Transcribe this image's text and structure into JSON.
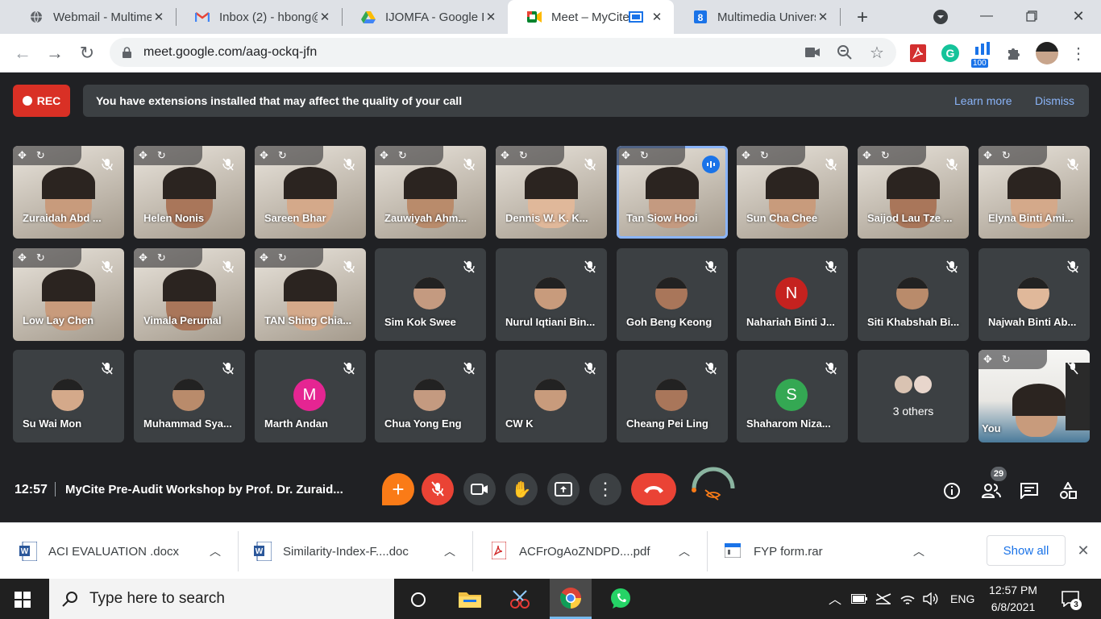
{
  "browser": {
    "tabs": [
      {
        "title": "Webmail - Multimedia",
        "icon": "globe-icon"
      },
      {
        "title": "Inbox (2) - hbong@",
        "icon": "gmail-icon"
      },
      {
        "title": "IJOMFA - Google Drive",
        "icon": "drive-icon"
      },
      {
        "title": "Meet – MyCite",
        "icon": "meet-icon"
      },
      {
        "title": "Multimedia University",
        "icon": "mmu-icon"
      }
    ],
    "url": "meet.google.com/aag-ockq-jfn",
    "badge_count": "100"
  },
  "meet": {
    "rec_label": "REC",
    "banner_text": "You have extensions installed that may affect the quality of your call",
    "learn_more": "Learn more",
    "dismiss": "Dismiss",
    "participants_row1": [
      {
        "name": "Zuraidah Abd ...",
        "video": true
      },
      {
        "name": "Helen Nonis",
        "video": true
      },
      {
        "name": "Sareen Bhar",
        "video": true
      },
      {
        "name": "Zauwiyah Ahm...",
        "video": true
      },
      {
        "name": "Dennis W. K. K...",
        "video": true
      },
      {
        "name": "Tan Siow Hooi",
        "video": true,
        "speaking": true
      },
      {
        "name": "Sun Cha Chee",
        "video": true
      },
      {
        "name": "Saijod Lau Tze ...",
        "video": true
      },
      {
        "name": "Elyna Binti Ami...",
        "video": true
      }
    ],
    "participants_row2": [
      {
        "name": "Low Lay Chen",
        "video": true
      },
      {
        "name": "Vimala Perumal",
        "video": true
      },
      {
        "name": "TAN Shing Chia...",
        "video": true
      },
      {
        "name": "Sim Kok Swee",
        "video": false
      },
      {
        "name": "Nurul Iqtiani Bin...",
        "video": false
      },
      {
        "name": "Goh Beng Keong",
        "video": false
      },
      {
        "name": "Nahariah Binti J...",
        "video": false,
        "initial": "N",
        "color": "#c5221f"
      },
      {
        "name": "Siti Khabshah Bi...",
        "video": false
      },
      {
        "name": "Najwah Binti Ab...",
        "video": false
      }
    ],
    "participants_row3": [
      {
        "name": "Su Wai Mon",
        "video": false
      },
      {
        "name": "Muhammad Sya...",
        "video": false
      },
      {
        "name": "Marth Andan",
        "video": false,
        "initial": "M",
        "color": "#e52592"
      },
      {
        "name": "Chua Yong Eng",
        "video": false
      },
      {
        "name": "CW K",
        "video": false
      },
      {
        "name": "Cheang Pei Ling",
        "video": false
      },
      {
        "name": "Shaharom Niza...",
        "video": false,
        "initial": "S",
        "color": "#34a853"
      }
    ],
    "others_label": "3 others",
    "self_label": "You",
    "time": "12:57",
    "meeting_title": "MyCite Pre-Audit Workshop by Prof. Dr. Zuraid...",
    "people_count": "29"
  },
  "downloads": {
    "items": [
      {
        "name": "ACI EVALUATION .docx",
        "icon": "word-icon"
      },
      {
        "name": "Similarity-Index-F....doc",
        "icon": "word-icon"
      },
      {
        "name": "ACFrOgAoZNDPD....pdf",
        "icon": "pdf-icon"
      },
      {
        "name": "FYP form.rar",
        "icon": "rar-icon"
      }
    ],
    "show_all": "Show all"
  },
  "taskbar": {
    "search_placeholder": "Type here to search",
    "lang": "ENG",
    "time": "12:57 PM",
    "date": "6/8/2021",
    "notif_count": "3"
  }
}
